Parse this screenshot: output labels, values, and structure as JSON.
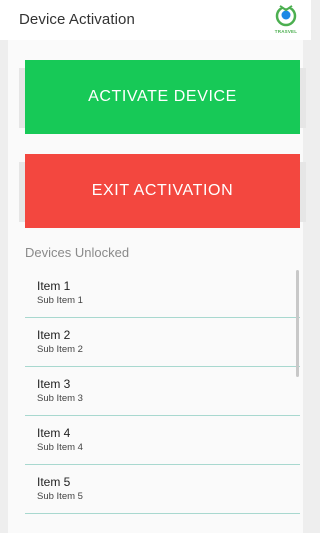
{
  "header": {
    "title": "Device Activation",
    "logo_text": "TRASVEL"
  },
  "actions": {
    "activate_label": "ACTIVATE DEVICE",
    "exit_label": "EXIT ACTIVATION",
    "activate_color": "#17c957",
    "exit_color": "#f3473f"
  },
  "devices": {
    "section_label": "Devices Unlocked",
    "items": [
      {
        "title": "Item 1",
        "subtitle": "Sub Item 1"
      },
      {
        "title": "Item 2",
        "subtitle": "Sub Item 2"
      },
      {
        "title": "Item 3",
        "subtitle": "Sub Item 3"
      },
      {
        "title": "Item 4",
        "subtitle": "Sub Item 4"
      },
      {
        "title": "Item 5",
        "subtitle": "Sub Item 5"
      }
    ]
  }
}
